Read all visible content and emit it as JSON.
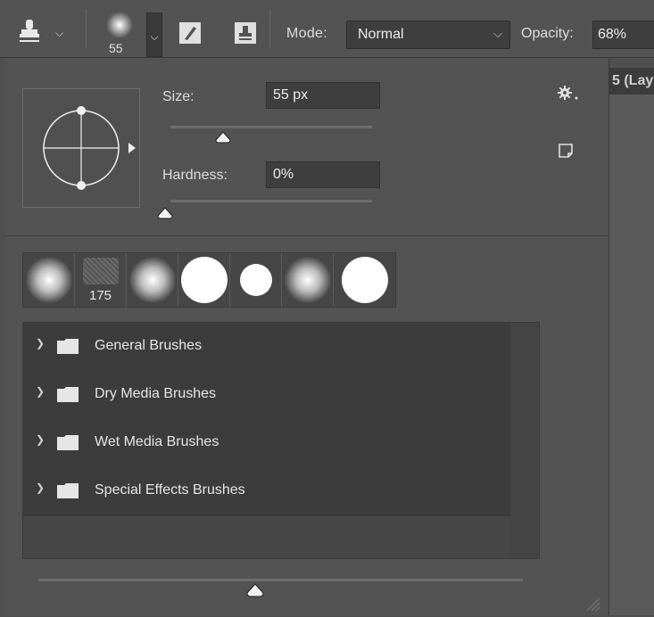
{
  "options_bar": {
    "brush_size": "55",
    "mode_label": "Mode:",
    "mode_value": "Normal",
    "opacity_label": "Opacity:",
    "opacity_value": "68%"
  },
  "document_tab": {
    "label": "5 (Lay"
  },
  "brush_panel": {
    "size_label": "Size:",
    "size_value": "55 px",
    "size_slider_fraction": 0.26,
    "hardness_label": "Hardness:",
    "hardness_value": "0%",
    "hardness_slider_fraction": 0.0,
    "presets": [
      {
        "kind": "soft",
        "number": ""
      },
      {
        "kind": "texture",
        "number": "175"
      },
      {
        "kind": "soft",
        "number": ""
      },
      {
        "kind": "hard",
        "number": ""
      },
      {
        "kind": "hard-small",
        "number": ""
      },
      {
        "kind": "soft",
        "number": ""
      },
      {
        "kind": "hard",
        "number": ""
      }
    ],
    "folders": [
      {
        "label": "General Brushes"
      },
      {
        "label": "Dry Media Brushes"
      },
      {
        "label": "Wet Media Brushes"
      },
      {
        "label": "Special Effects Brushes"
      }
    ],
    "preview_size_fraction": 0.45
  },
  "icons": {
    "tool": "stamp-icon",
    "brush_settings": "brush-settings-icon",
    "clone_source": "clone-source-icon",
    "gear": "gear-icon",
    "new_preset": "new-preset-icon",
    "folder": "folder-icon",
    "chevron": "chevron-right-icon"
  }
}
